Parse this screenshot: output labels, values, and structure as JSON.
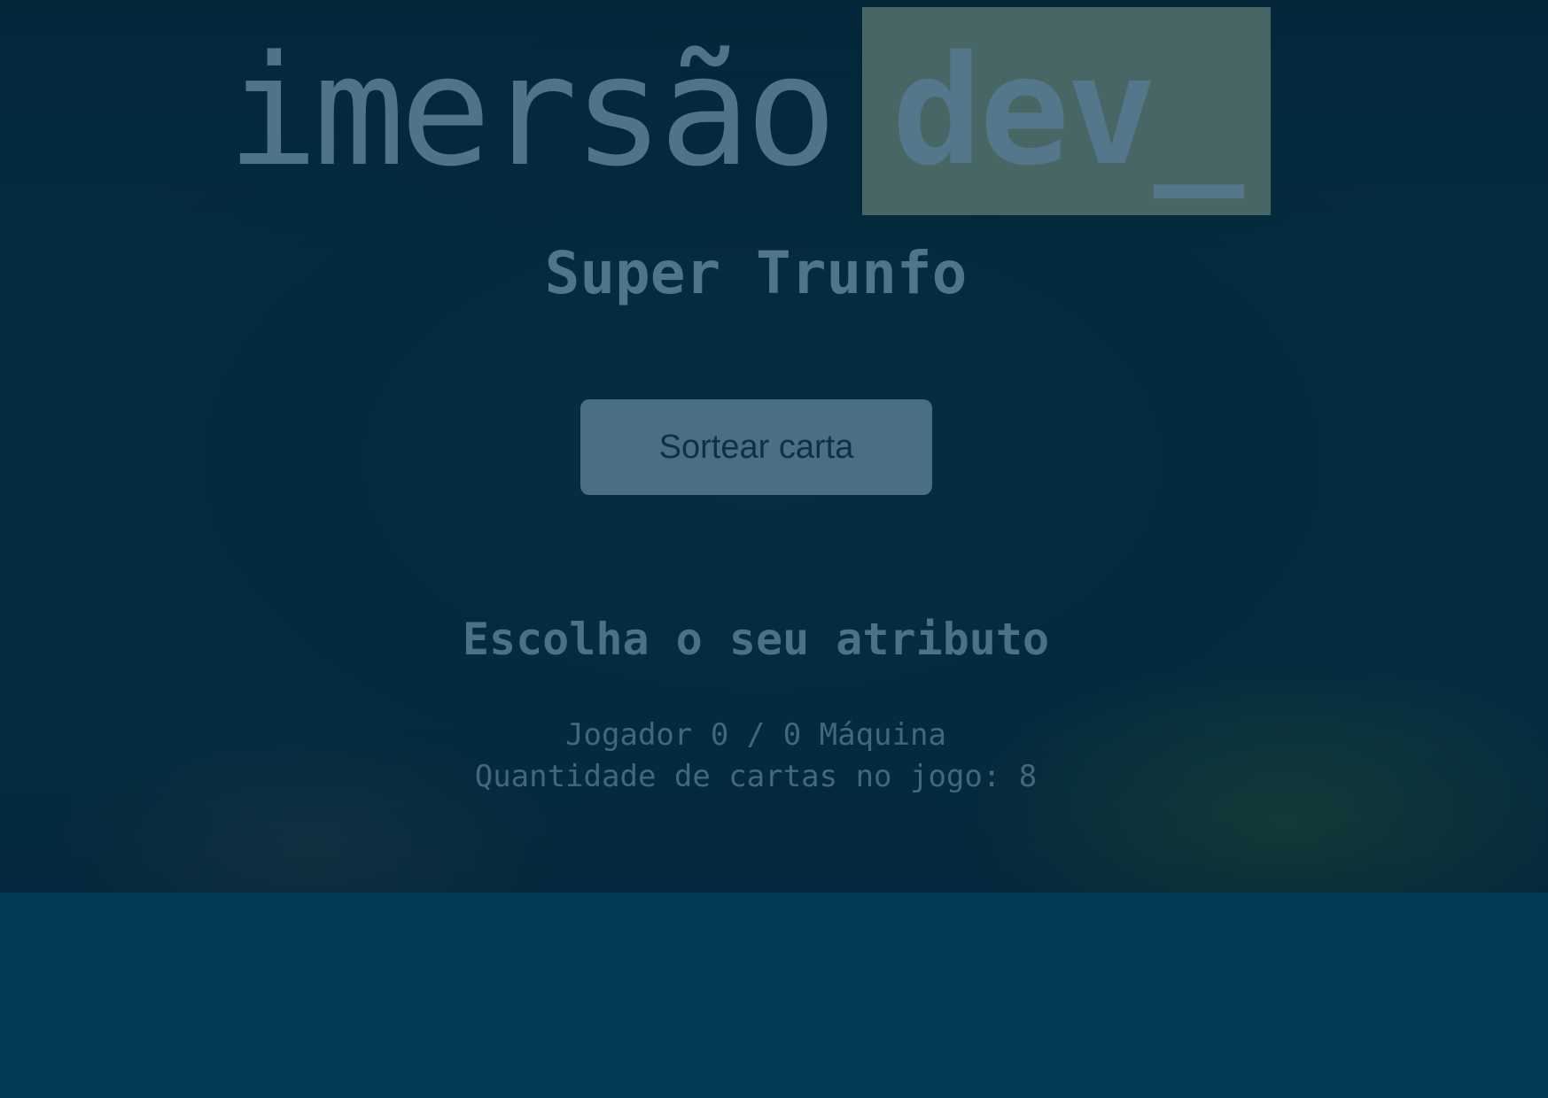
{
  "logo": {
    "word": "imersão",
    "highlight": "dev_"
  },
  "title": "Super Trunfo",
  "draw_button_label": "Sortear carta",
  "subtitle": "Escolha o seu atributo",
  "score": "Jogador 0 / 0 Máquina",
  "card_count": "Quantidade de cartas no jogo: 8",
  "colors": {
    "background": "#053a56",
    "logo_box": "#476664",
    "button": "#4a6e82"
  }
}
